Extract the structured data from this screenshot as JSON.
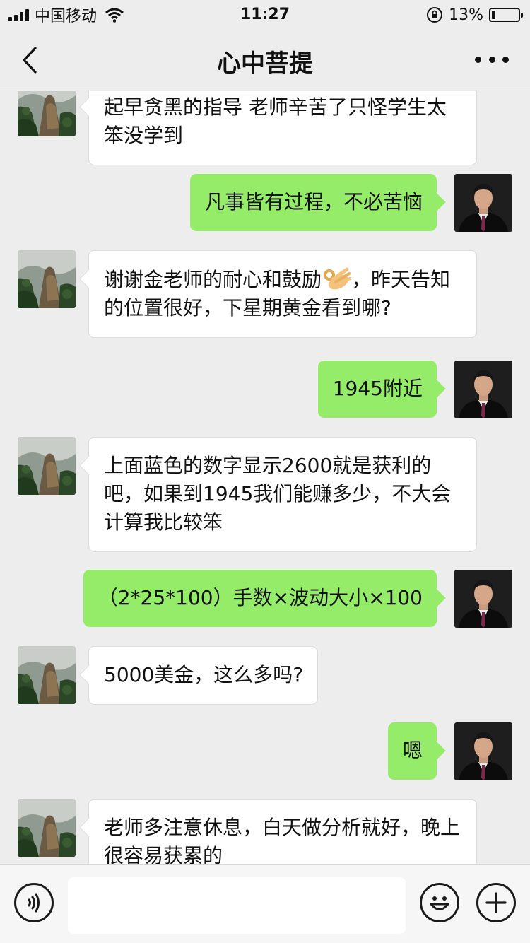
{
  "status_bar": {
    "carrier": "中国移动",
    "time": "11:27",
    "battery_percent": "13%",
    "battery_level": 0.13
  },
  "nav": {
    "title": "心中菩提"
  },
  "messages": [
    {
      "side": "left",
      "text": "起早贪黑的指导 老师辛苦了只怪学生太笨没学到"
    },
    {
      "side": "right",
      "text": "凡事皆有过程，不必苦恼"
    },
    {
      "side": "left",
      "text_before": "谢谢金老师的耐心和鼓励",
      "emoji": "ok-hand-emoji",
      "text_after": "，昨天告知的位置很好，下星期黄金看到哪?"
    },
    {
      "side": "right",
      "text": "1945附近"
    },
    {
      "side": "left",
      "text": "上面蓝色的数字显示2600就是获利的吧，如果到1945我们能赚多少，不大会计算我比较笨"
    },
    {
      "side": "right",
      "text": "（2*25*100）手数×波动大小×100"
    },
    {
      "side": "left",
      "text": "5000美金，这么多吗?"
    },
    {
      "side": "right",
      "text": "嗯"
    },
    {
      "side": "left",
      "text": "老师多注意休息，白天做分析就好，晚上很容易获累的"
    }
  ],
  "input_bar": {
    "placeholder": "",
    "icons": [
      "voice-icon",
      "emoji-face-icon",
      "plus-icon"
    ]
  },
  "colors": {
    "background": "#ededed",
    "sent_bubble": "#95ec69",
    "received_bubble": "#ffffff"
  }
}
